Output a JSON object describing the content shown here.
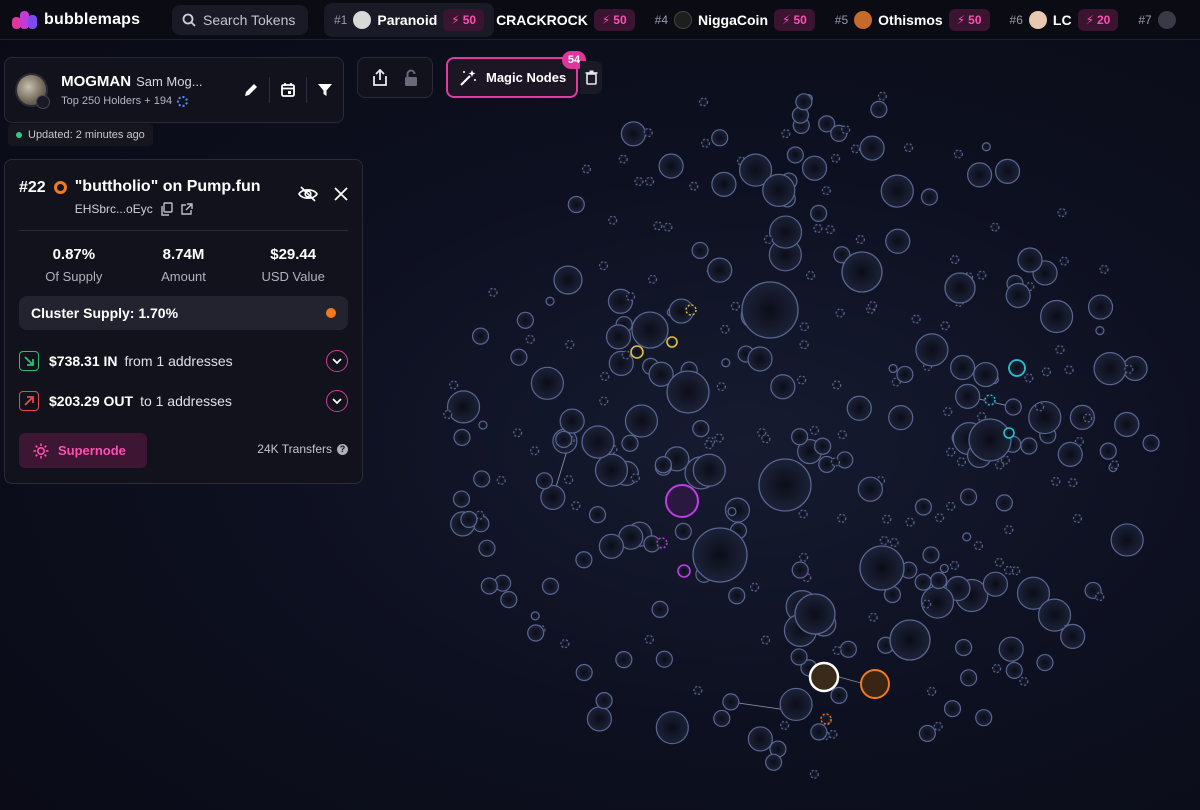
{
  "topbar": {
    "logo_text": "bubblemaps",
    "search_label": "Search Tokens",
    "trending": [
      {
        "rank": "#1",
        "name": "Paranoid",
        "boost": "50"
      },
      {
        "rank": "",
        "name": "CRACKROCK",
        "boost": "50"
      },
      {
        "rank": "#4",
        "name": "NiggaCoin",
        "boost": "50"
      },
      {
        "rank": "#5",
        "name": "Othismos",
        "boost": "50"
      },
      {
        "rank": "#6",
        "name": "LC",
        "boost": "20"
      },
      {
        "rank": "#7",
        "name": "",
        "boost": ""
      }
    ]
  },
  "token": {
    "symbol": "MOGMAN",
    "name": "Sam Mog...",
    "holders_text": "Top 250 Holders + 194",
    "updated_text": "Updated: 2 minutes ago"
  },
  "magic_nodes": {
    "label": "Magic Nodes",
    "count": "54"
  },
  "node_panel": {
    "rank": "#22",
    "title": "\"buttholio\" on Pump.fun",
    "address": "EHSbrc...oEyc",
    "stats": [
      {
        "value": "0.87%",
        "label": "Of Supply"
      },
      {
        "value": "8.74M",
        "label": "Amount"
      },
      {
        "value": "$29.44",
        "label": "USD Value"
      }
    ],
    "cluster_supply": "Cluster Supply: 1.70%",
    "inflow": {
      "amount": "$738.31 IN",
      "text": "from 1 addresses"
    },
    "outflow": {
      "amount": "$203.29 OUT",
      "text": "to 1 addresses"
    },
    "supernode_label": "Supernode",
    "transfers_text": "24K Transfers",
    "help": "?"
  },
  "colors": {
    "accent_pink": "#e23a9e",
    "cluster_orange": "#f07a1c",
    "in_green": "#2fbf71",
    "out_red": "#e5484d",
    "bubble_fill": "#1c2238",
    "bubble_stroke": "#5a6690"
  },
  "icons": {
    "search": "search-icon",
    "edit": "pencil-icon",
    "calendar": "calendar-icon",
    "filter": "filter-icon",
    "share": "share-icon",
    "lock": "lock-icon",
    "magic": "magic-wand-icon",
    "trash": "trash-icon",
    "hide": "eye-off-icon",
    "close": "close-icon",
    "copy": "copy-icon",
    "external": "external-link-icon",
    "supernode": "sun-icon"
  }
}
